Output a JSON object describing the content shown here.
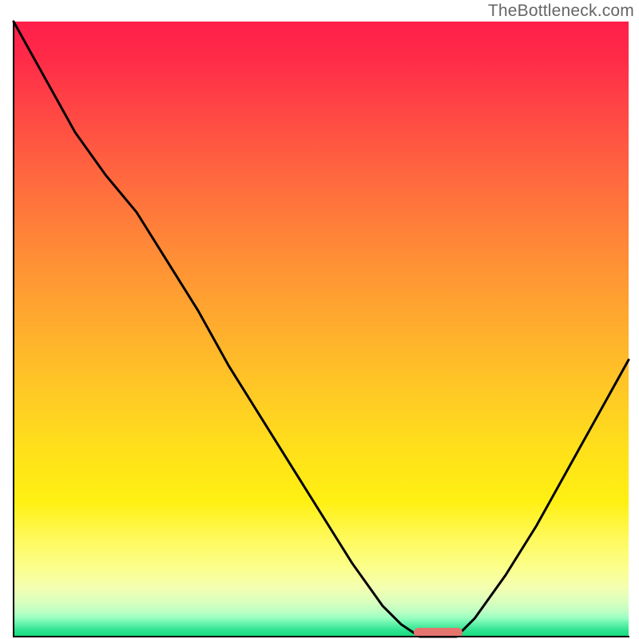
{
  "watermark": "TheBottleneck.com",
  "colors": {
    "curve_stroke": "#000000",
    "axis": "#000000",
    "marker": "#e4756e",
    "watermark_text": "#666666"
  },
  "chart_data": {
    "type": "line",
    "title": "",
    "xlabel": "",
    "ylabel": "",
    "xlim": [
      0,
      100
    ],
    "ylim": [
      0,
      100
    ],
    "grid": false,
    "legend": false,
    "note": "Axes are unlabeled; x is relative horizontal position, y is relative height of the curve (100 = top, 0 = bottom). Values estimated from pixels.",
    "categories": [
      0,
      5,
      10,
      15,
      20,
      25,
      30,
      35,
      40,
      45,
      50,
      55,
      60,
      63,
      66,
      70,
      72,
      75,
      80,
      85,
      90,
      95,
      100
    ],
    "values": [
      100,
      91,
      82,
      75,
      69,
      61,
      53,
      44,
      36,
      28,
      20,
      12,
      5,
      2,
      0,
      0,
      0,
      3,
      10,
      18,
      27,
      36,
      45
    ],
    "marker": {
      "note": "Short rounded horizontal bar at the curve's flat minimum",
      "x_range_pct": [
        65,
        73
      ],
      "y_pct": 0.7
    }
  }
}
